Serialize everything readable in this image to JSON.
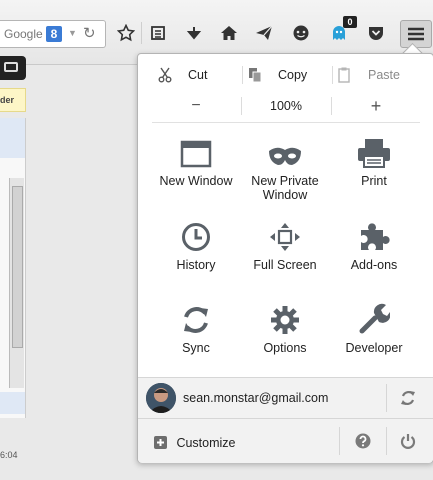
{
  "search": {
    "text": "Google",
    "engine_letter": "8"
  },
  "toolbar": {
    "notification_count": "0"
  },
  "background": {
    "yellow_label": "der",
    "timestamp": "6:04"
  },
  "menu": {
    "edit": {
      "cut": "Cut",
      "copy": "Copy",
      "paste": "Paste"
    },
    "zoom": {
      "out": "−",
      "level": "100%",
      "in": "+"
    },
    "items": [
      {
        "label": "New Window",
        "icon": "window-icon"
      },
      {
        "label": "New Private\nWindow",
        "icon": "mask-icon"
      },
      {
        "label": "Print",
        "icon": "printer-icon"
      },
      {
        "label": "History",
        "icon": "clock-icon"
      },
      {
        "label": "Full Screen",
        "icon": "fullscreen-icon"
      },
      {
        "label": "Add-ons",
        "icon": "puzzle-icon"
      },
      {
        "label": "Sync",
        "icon": "sync-icon"
      },
      {
        "label": "Options",
        "icon": "gear-icon"
      },
      {
        "label": "Developer",
        "icon": "wrench-icon"
      }
    ],
    "account": {
      "email": "sean.monstar@gmail.com"
    },
    "customize": "Customize"
  }
}
